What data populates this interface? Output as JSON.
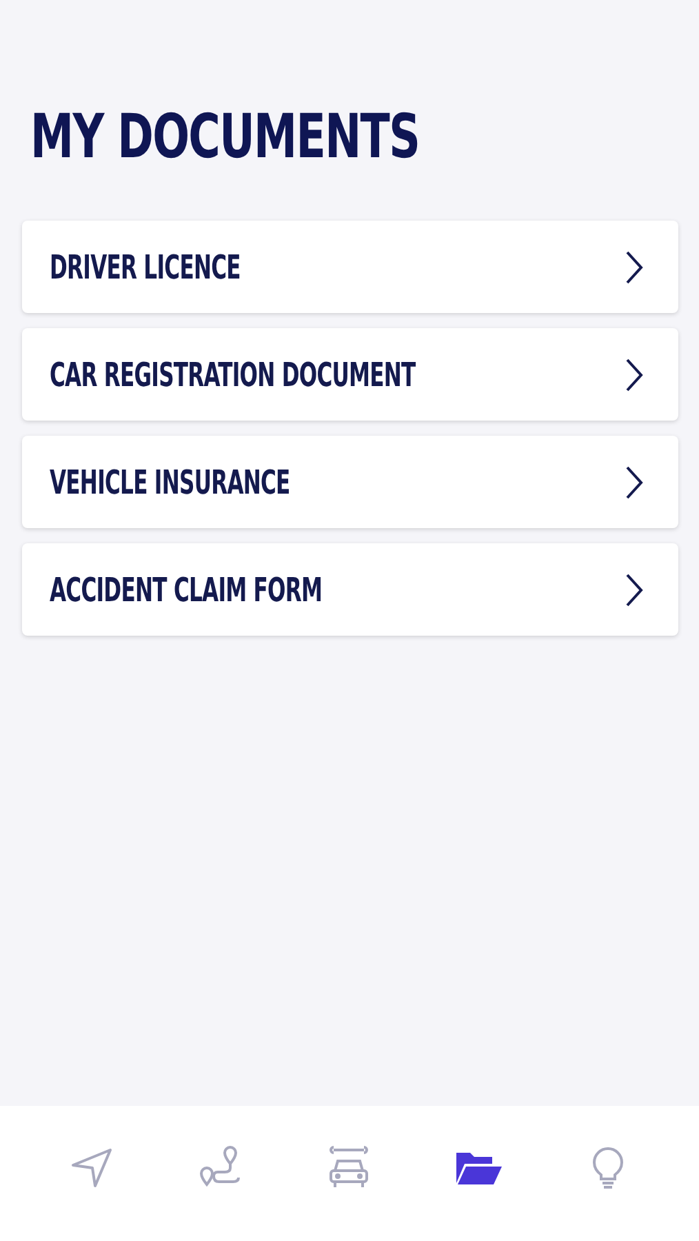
{
  "title": "MY DOCUMENTS",
  "documents": [
    {
      "label": "DRIVER LICENCE"
    },
    {
      "label": "CAR REGISTRATION DOCUMENT"
    },
    {
      "label": "VEHICLE INSURANCE"
    },
    {
      "label": "ACCIDENT CLAIM FORM"
    }
  ],
  "tab_bar": [
    {
      "kind": "navigate",
      "selected": false
    },
    {
      "kind": "route",
      "selected": false
    },
    {
      "kind": "car",
      "selected": false
    },
    {
      "kind": "documents",
      "selected": true
    },
    {
      "kind": "tips",
      "selected": false
    }
  ]
}
